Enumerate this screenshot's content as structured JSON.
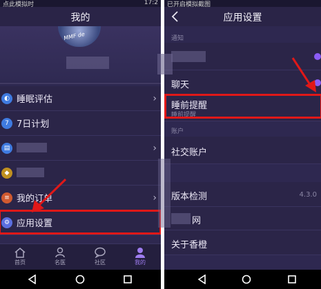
{
  "left": {
    "status_text": "点此模拟时",
    "status_time": "17:2",
    "title": "我的",
    "avatar_text": "MMF de",
    "menu": [
      {
        "label": "睡眠评估",
        "icon": "moon-icon",
        "icon_glyph": "◐"
      },
      {
        "label": "7日计划",
        "icon": "calendar-icon",
        "icon_glyph": "7"
      },
      {
        "label": "",
        "icon": "report-icon",
        "icon_glyph": "▤"
      },
      {
        "label": "",
        "icon": "tag-icon",
        "icon_glyph": "◆"
      },
      {
        "label": "我的订单",
        "icon": "order-icon",
        "icon_glyph": "≡"
      },
      {
        "label": "应用设置",
        "icon": "gear-icon",
        "icon_glyph": "⚙"
      }
    ],
    "tabs": [
      {
        "label": "首页",
        "icon": "home-icon"
      },
      {
        "label": "名医",
        "icon": "doctor-icon"
      },
      {
        "label": "社区",
        "icon": "community-icon"
      },
      {
        "label": "我的",
        "icon": "profile-icon"
      }
    ]
  },
  "right": {
    "status_text": "已开启模拟截图",
    "title": "应用设置",
    "sections": {
      "notify": "通知",
      "account": "账户"
    },
    "rows": {
      "chat": "聊天",
      "sleep_reminder": "睡前提醒",
      "sleep_reminder_sub": "睡前提醒",
      "social": "社交账户",
      "version": "版本检测",
      "version_value": "4.3.0",
      "website": "网",
      "about": "关于香橙"
    }
  },
  "colors": {
    "background": "#2e2850",
    "highlight": "#e01818",
    "accent": "#8b5cf6",
    "menu_icon": "#3f7be0"
  }
}
